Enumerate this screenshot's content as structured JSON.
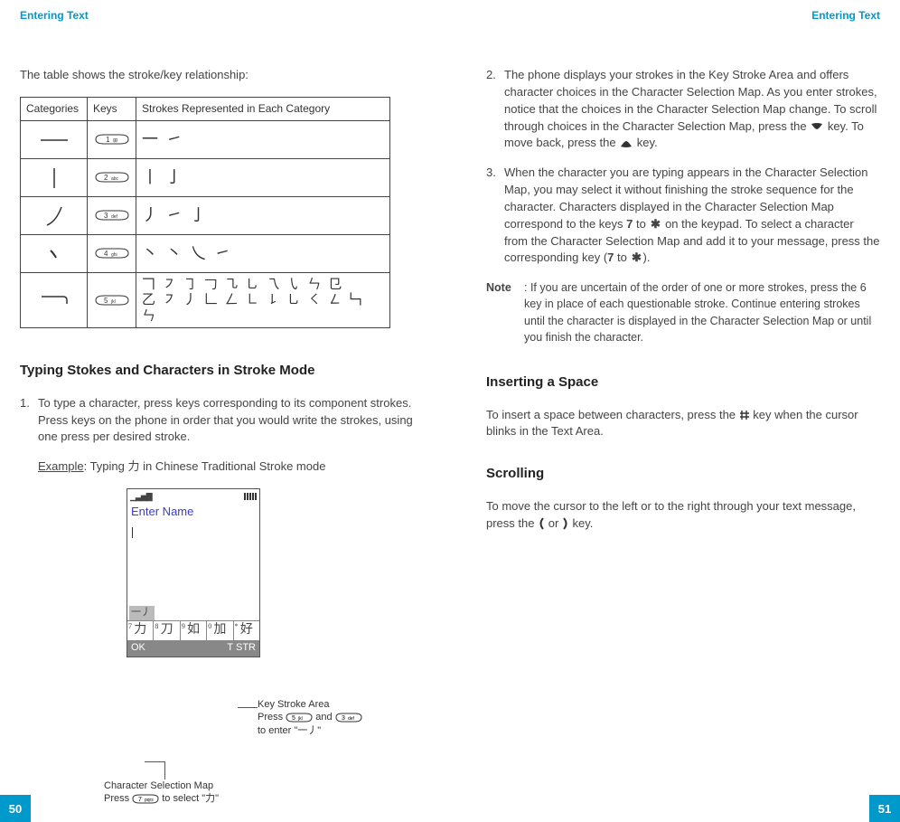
{
  "header": {
    "left": "Entering Text",
    "right": "Entering Text"
  },
  "pagenum": {
    "left": "50",
    "right": "51"
  },
  "left": {
    "intro": "The table shows the stroke/key relationship:",
    "table": {
      "col_categories": "Categories",
      "col_keys": "Keys",
      "col_strokes": "Strokes Represented in Each Category",
      "rows": [
        {
          "key": "1",
          "cat_svg": "h",
          "strokes": "一 ㇀"
        },
        {
          "key": "2",
          "cat_svg": "v",
          "strokes": "丨 亅"
        },
        {
          "key": "3",
          "cat_svg": "pie",
          "strokes": "丿 ㇀ 亅"
        },
        {
          "key": "4",
          "cat_svg": "dot",
          "strokes": "丶 丶 乀 ㇀"
        },
        {
          "key": "5",
          "cat_svg": "hook",
          "strokes": "𠃍 ㇇ ㇆ 𠃌 ㇈ ㇟ 乁 ㇂ ㄣ 㔾\n乙 ㇇ 丿 𠃊 ㄥ ㇗ ㇙ ㇟ ㇛ ㇜ 𠃑 ㄣ"
        }
      ]
    },
    "h2": "Typing Stokes and Characters in Stroke Mode",
    "step1": "To type a character, press keys corresponding to its component strokes. Press keys on the phone in order that you would write the strokes, using one press per desired stroke.",
    "example_label": "Example",
    "example_rest": ": Typing  力 in Chinese Traditional Stroke mode",
    "phone": {
      "title": "Enter Name",
      "ksa": "一丿",
      "csm": [
        {
          "sup": "7",
          "ch": "力"
        },
        {
          "sup": "8",
          "ch": "刀"
        },
        {
          "sup": "9",
          "ch": "如"
        },
        {
          "sup": "0",
          "ch": "加"
        },
        {
          "sup": "*",
          "ch": "好"
        }
      ],
      "soft_left": "OK",
      "soft_right": "T STR"
    },
    "callout_ksa_l1": "Key Stroke Area",
    "callout_ksa_l2a": "Press ",
    "callout_ksa_l2b": " and ",
    "callout_ksa_l3a": "to enter \"",
    "callout_ksa_l3b": "一丿",
    "callout_ksa_l3c": "\"",
    "callout_csm_l1": "Character Selection Map",
    "callout_csm_l2a": "Press  ",
    "callout_csm_l2b": " to select \"力\""
  },
  "right": {
    "step2a": "The phone displays your strokes in the Key Stroke Area and offers character choices in the Character Selection Map. As you enter strokes, notice that the choices in the Character Selection Map change. To scroll through choices in the Character Selection Map, press the ",
    "step2b": " key. To move back, press the ",
    "step2c": " key.",
    "step3a": "When the character you are typing appears in the Character Selection Map, you may select it without finishing the stroke sequence for the character. Characters displayed in the Character Selection Map correspond to the keys ",
    "step3b": " to ",
    "step3c": " on the keypad. To select a character from the Character Selection Map and add it to your message, press the corresponding key (",
    "step3d": " to ",
    "step3e": ").",
    "key7": "7",
    "note_label": "Note",
    "note_text": ": If you are uncertain of the order of one or more strokes, press the 6 key in place of each questionable stroke. Continue entering strokes until the character is displayed in the Character Selection Map or until you finish the character.",
    "h2a": "Inserting a Space",
    "space_a": "To insert a space between characters, press the ",
    "space_b": " key when the cursor blinks in the Text Area.",
    "h2b": "Scrolling",
    "scroll_a": "To move the cursor to the left or to the right through your text message, press the ",
    "scroll_b": " or ",
    "scroll_c": " key."
  }
}
